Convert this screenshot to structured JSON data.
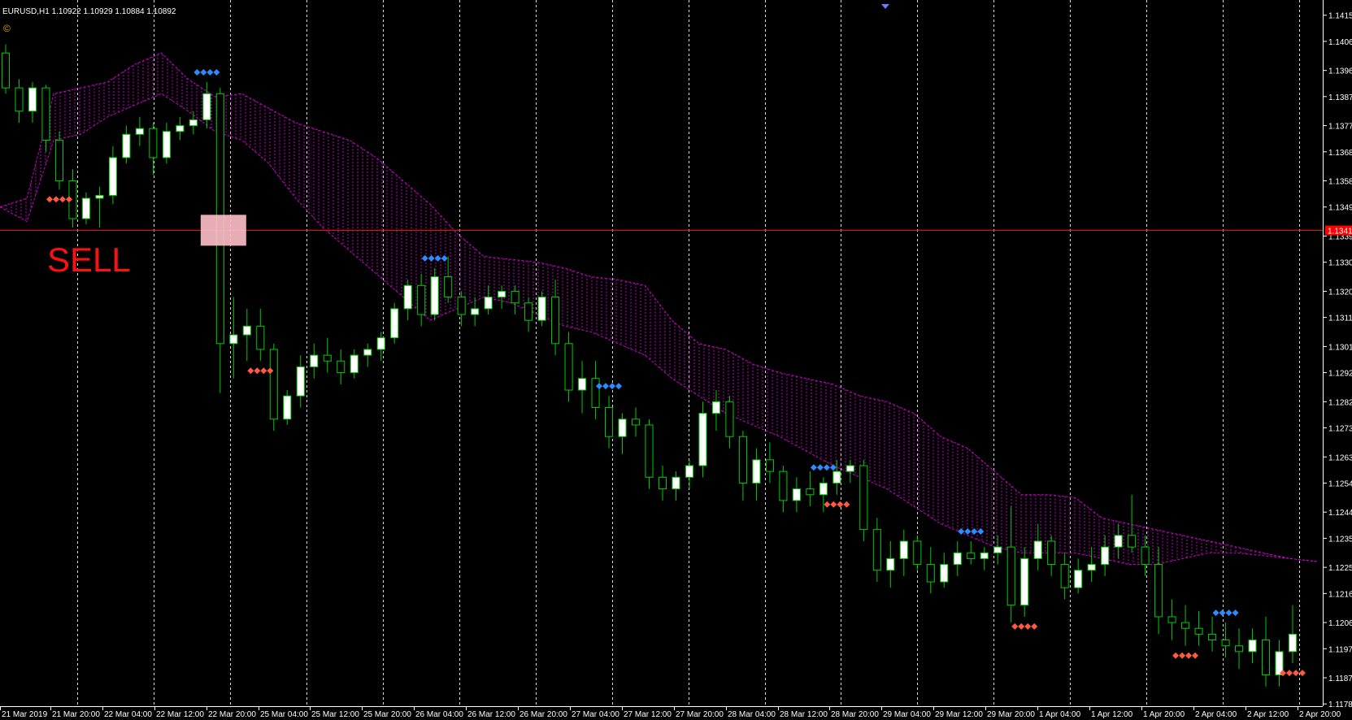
{
  "header": {
    "symbol_info": "EURUSD,H1  1.10922 1.10929 1.10884 1.10892",
    "copyright_glyph": "©"
  },
  "annotation": {
    "text": "SELL",
    "color": "#ff1010"
  },
  "colors": {
    "background": "#000000",
    "bull_candle": "#ffffff",
    "candle_outline": "#00cc00",
    "wick": "#00cc00",
    "cloud": "#cc00cc",
    "hline": "#ff0000",
    "grid": "#ffffff",
    "marker_top": "#2a8cff",
    "marker_bottom": "#ff5a40",
    "sell_box": "#ffc0cb"
  },
  "chart_data": {
    "type": "candlestick",
    "title": "EURUSD,H1",
    "ylim": [
      1.11775,
      1.1418
    ],
    "y_ticks": [
      "1.1415",
      "1.1406",
      "1.1396",
      "1.1387",
      "1.1377",
      "1.1368",
      "1.1358",
      "1.1349",
      "1.1339",
      "1.1330",
      "1.1320",
      "1.1311",
      "1.1301",
      "1.1292",
      "1.1282",
      "1.1273",
      "1.1263",
      "1.1254",
      "1.1244",
      "1.1235",
      "1.1225",
      "1.1216",
      "1.1206",
      "1.1197",
      "1.1187",
      "1.1178"
    ],
    "x_ticks": [
      "21 Mar 2019",
      "21 Mar 20:00",
      "22 Mar 04:00",
      "22 Mar 12:00",
      "22 Mar 20:00",
      "25 Mar 04:00",
      "25 Mar 12:00",
      "25 Mar 20:00",
      "26 Mar 04:00",
      "26 Mar 12:00",
      "26 Mar 20:00",
      "27 Mar 04:00",
      "27 Mar 12:00",
      "27 Mar 20:00",
      "28 Mar 04:00",
      "28 Mar 12:00",
      "28 Mar 20:00",
      "29 Mar 04:00",
      "29 Mar 12:00",
      "29 Mar 20:00",
      "1 Apr 04:00",
      "1 Apr 12:00",
      "1 Apr 20:00",
      "2 Apr 04:00",
      "2 Apr 12:00",
      "2 Apr 20:00"
    ],
    "horizontal_line": {
      "price": 1.1341,
      "label": "1.13410"
    },
    "sell_level": 1.1341,
    "series": [
      {
        "name": "EURUSD",
        "ohlc": [
          [
            1.1402,
            1.1405,
            1.1388,
            1.139
          ],
          [
            1.139,
            1.1393,
            1.1378,
            1.1382
          ],
          [
            1.1382,
            1.1392,
            1.1378,
            1.139
          ],
          [
            1.139,
            1.1391,
            1.1368,
            1.1372
          ],
          [
            1.1372,
            1.1375,
            1.1355,
            1.1358
          ],
          [
            1.1358,
            1.1362,
            1.1342,
            1.1345
          ],
          [
            1.1345,
            1.1354,
            1.1343,
            1.1352
          ],
          [
            1.1352,
            1.1356,
            1.1342,
            1.1353
          ],
          [
            1.1353,
            1.137,
            1.135,
            1.1366
          ],
          [
            1.1366,
            1.1377,
            1.1364,
            1.1374
          ],
          [
            1.1374,
            1.138,
            1.137,
            1.1376
          ],
          [
            1.1376,
            1.1378,
            1.136,
            1.1366
          ],
          [
            1.1366,
            1.1378,
            1.1364,
            1.1375
          ],
          [
            1.1375,
            1.138,
            1.1372,
            1.1377
          ],
          [
            1.1377,
            1.1382,
            1.1374,
            1.1379
          ],
          [
            1.1379,
            1.1392,
            1.1376,
            1.1388
          ],
          [
            1.1388,
            1.139,
            1.1285,
            1.1302
          ],
          [
            1.1302,
            1.1318,
            1.129,
            1.1305
          ],
          [
            1.1305,
            1.1314,
            1.1296,
            1.1308
          ],
          [
            1.1308,
            1.1314,
            1.1296,
            1.13
          ],
          [
            1.13,
            1.1302,
            1.1272,
            1.1276
          ],
          [
            1.1276,
            1.1286,
            1.1274,
            1.1284
          ],
          [
            1.1284,
            1.1298,
            1.128,
            1.1294
          ],
          [
            1.1294,
            1.1302,
            1.129,
            1.1298
          ],
          [
            1.1298,
            1.1304,
            1.1292,
            1.1296
          ],
          [
            1.1296,
            1.13,
            1.1288,
            1.1292
          ],
          [
            1.1292,
            1.13,
            1.129,
            1.1298
          ],
          [
            1.1298,
            1.1302,
            1.1294,
            1.13
          ],
          [
            1.13,
            1.1306,
            1.1296,
            1.1304
          ],
          [
            1.1304,
            1.1316,
            1.1302,
            1.1314
          ],
          [
            1.1314,
            1.1324,
            1.131,
            1.1322
          ],
          [
            1.1322,
            1.1326,
            1.1308,
            1.1312
          ],
          [
            1.1312,
            1.1328,
            1.131,
            1.1325
          ],
          [
            1.1325,
            1.1332,
            1.1316,
            1.1318
          ],
          [
            1.1318,
            1.132,
            1.1308,
            1.1312
          ],
          [
            1.1312,
            1.1318,
            1.1308,
            1.1314
          ],
          [
            1.1314,
            1.1322,
            1.1312,
            1.1318
          ],
          [
            1.1318,
            1.1322,
            1.1314,
            1.132
          ],
          [
            1.132,
            1.1322,
            1.1312,
            1.1316
          ],
          [
            1.1316,
            1.1318,
            1.1306,
            1.131
          ],
          [
            1.131,
            1.132,
            1.1308,
            1.1318
          ],
          [
            1.1318,
            1.1324,
            1.1298,
            1.1302
          ],
          [
            1.1302,
            1.1306,
            1.1282,
            1.1286
          ],
          [
            1.1286,
            1.1296,
            1.1278,
            1.129
          ],
          [
            1.129,
            1.1296,
            1.1276,
            1.128
          ],
          [
            1.128,
            1.1284,
            1.1266,
            1.127
          ],
          [
            1.127,
            1.1278,
            1.1264,
            1.1276
          ],
          [
            1.1276,
            1.128,
            1.127,
            1.1274
          ],
          [
            1.1274,
            1.1276,
            1.1252,
            1.1256
          ],
          [
            1.1256,
            1.126,
            1.1248,
            1.1252
          ],
          [
            1.1252,
            1.1258,
            1.1248,
            1.1256
          ],
          [
            1.1256,
            1.1262,
            1.1252,
            1.126
          ],
          [
            1.126,
            1.1282,
            1.1256,
            1.1278
          ],
          [
            1.1278,
            1.1286,
            1.1272,
            1.1282
          ],
          [
            1.1282,
            1.1284,
            1.1266,
            1.127
          ],
          [
            1.127,
            1.1272,
            1.1248,
            1.1254
          ],
          [
            1.1254,
            1.1266,
            1.1248,
            1.1262
          ],
          [
            1.1262,
            1.1268,
            1.1254,
            1.1258
          ],
          [
            1.1258,
            1.126,
            1.1244,
            1.1248
          ],
          [
            1.1248,
            1.1256,
            1.1244,
            1.1252
          ],
          [
            1.1252,
            1.1258,
            1.1246,
            1.125
          ],
          [
            1.125,
            1.1256,
            1.1244,
            1.1254
          ],
          [
            1.1254,
            1.1262,
            1.125,
            1.1258
          ],
          [
            1.1258,
            1.1262,
            1.1254,
            1.126
          ],
          [
            1.126,
            1.1262,
            1.1234,
            1.1238
          ],
          [
            1.1238,
            1.1242,
            1.122,
            1.1224
          ],
          [
            1.1224,
            1.1234,
            1.1218,
            1.1228
          ],
          [
            1.1228,
            1.1238,
            1.1222,
            1.1234
          ],
          [
            1.1234,
            1.1236,
            1.1224,
            1.1226
          ],
          [
            1.1226,
            1.1232,
            1.1216,
            1.122
          ],
          [
            1.122,
            1.123,
            1.1218,
            1.1226
          ],
          [
            1.1226,
            1.1234,
            1.1222,
            1.123
          ],
          [
            1.123,
            1.1234,
            1.1226,
            1.1228
          ],
          [
            1.1228,
            1.1232,
            1.1224,
            1.123
          ],
          [
            1.123,
            1.1236,
            1.1226,
            1.1232
          ],
          [
            1.1232,
            1.1246,
            1.1206,
            1.1212
          ],
          [
            1.1212,
            1.1232,
            1.1208,
            1.1228
          ],
          [
            1.1228,
            1.124,
            1.1224,
            1.1234
          ],
          [
            1.1234,
            1.1236,
            1.1222,
            1.1226
          ],
          [
            1.1226,
            1.123,
            1.1214,
            1.1218
          ],
          [
            1.1218,
            1.1228,
            1.1216,
            1.1224
          ],
          [
            1.1224,
            1.1232,
            1.122,
            1.1226
          ],
          [
            1.1226,
            1.1236,
            1.1222,
            1.1232
          ],
          [
            1.1232,
            1.124,
            1.1228,
            1.1236
          ],
          [
            1.1236,
            1.125,
            1.123,
            1.1232
          ],
          [
            1.1232,
            1.1236,
            1.1222,
            1.1226
          ],
          [
            1.1226,
            1.1232,
            1.1202,
            1.1208
          ],
          [
            1.1208,
            1.1214,
            1.12,
            1.1206
          ],
          [
            1.1206,
            1.1212,
            1.1198,
            1.1204
          ],
          [
            1.1204,
            1.121,
            1.1198,
            1.1202
          ],
          [
            1.1202,
            1.1208,
            1.1196,
            1.12
          ],
          [
            1.12,
            1.1206,
            1.1194,
            1.1198
          ],
          [
            1.1198,
            1.1204,
            1.119,
            1.1196
          ],
          [
            1.1196,
            1.1204,
            1.1192,
            1.12
          ],
          [
            1.12,
            1.1208,
            1.1184,
            1.1188
          ],
          [
            1.1188,
            1.12,
            1.1184,
            1.1196
          ],
          [
            1.1196,
            1.1212,
            1.1192,
            1.1202
          ]
        ]
      },
      {
        "name": "cloud_upper",
        "values": [
          1.1349,
          1.1352,
          1.1388,
          1.139,
          1.1392,
          1.1398,
          1.1402,
          1.1393,
          1.1387,
          1.1388,
          1.1383,
          1.1378,
          1.1375,
          1.1372,
          1.1366,
          1.1358,
          1.135,
          1.134,
          1.1332,
          1.1331,
          1.133,
          1.1328,
          1.1325,
          1.1324,
          1.1322,
          1.131,
          1.1302,
          1.13,
          1.1295,
          1.1292,
          1.129,
          1.1288,
          1.1284,
          1.1282,
          1.1278,
          1.127,
          1.1266,
          1.1258,
          1.125,
          1.125,
          1.1249,
          1.1242,
          1.124,
          1.1238,
          1.1236,
          1.1234,
          1.1232,
          1.123,
          1.1228,
          1.1227
        ]
      },
      {
        "name": "cloud_lower",
        "values": [
          1.1349,
          1.1344,
          1.1372,
          1.1374,
          1.138,
          1.1384,
          1.1388,
          1.1382,
          1.1375,
          1.1372,
          1.1364,
          1.1352,
          1.1342,
          1.1334,
          1.1326,
          1.1318,
          1.131,
          1.1314,
          1.1318,
          1.1316,
          1.1312,
          1.1308,
          1.1306,
          1.1302,
          1.1298,
          1.129,
          1.1284,
          1.1278,
          1.1274,
          1.127,
          1.1265,
          1.126,
          1.1256,
          1.1252,
          1.1246,
          1.124,
          1.1236,
          1.1232,
          1.123,
          1.123,
          1.123,
          1.1228,
          1.1226,
          1.1226,
          1.1228,
          1.123,
          1.123,
          1.1229,
          1.1228,
          1.1227
        ]
      }
    ],
    "markers_top": [
      15,
      32,
      45,
      61,
      72,
      91,
      102
    ],
    "markers_bottom": [
      4,
      19,
      62,
      76,
      88,
      96
    ]
  }
}
